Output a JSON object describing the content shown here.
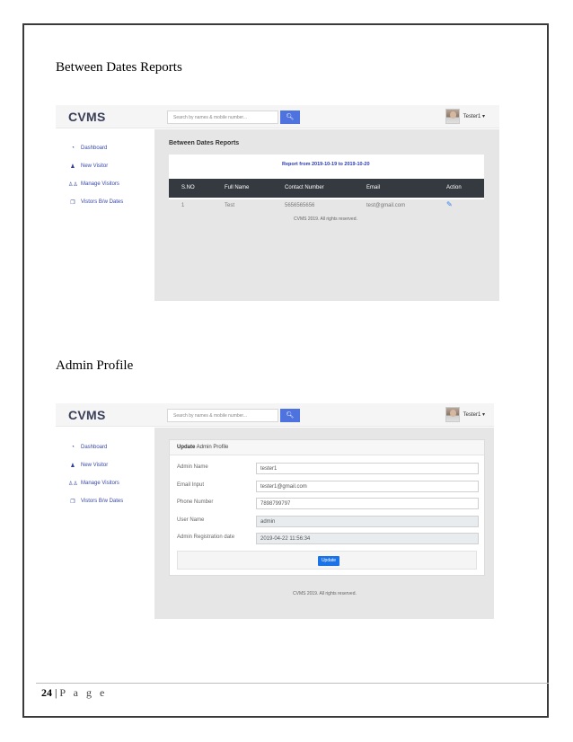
{
  "section1": {
    "heading": "Between Dates Reports"
  },
  "section2": {
    "heading": "Admin Profile"
  },
  "app": {
    "brand": "CVMS",
    "search_placeholder": "Search by names & mobile number...",
    "search_icon": "search-icon",
    "user_name": "Tester1 ▾",
    "sidebar": [
      {
        "label": "Dashboard",
        "icon": "dashboard-icon"
      },
      {
        "label": "New Visitor",
        "icon": "user-icon"
      },
      {
        "label": "Manage Visitors",
        "icon": "users-icon"
      },
      {
        "label": "Vistors B/w Dates",
        "icon": "copy-icon"
      }
    ],
    "footer": "CVMS 2019. All rights reserved."
  },
  "report": {
    "title": "Between Dates Reports",
    "range": "Report from 2019-10-19 to 2019-10-20",
    "columns": [
      "S.NO",
      "Full Name",
      "Contact Number",
      "Email",
      "Action"
    ],
    "rows": [
      {
        "sno": "1",
        "name": "Test",
        "contact": "5656565656",
        "email": "test@gmail.com"
      }
    ]
  },
  "profile": {
    "header_bold": "Update",
    "header_rest": " Admin Profile",
    "fields": [
      {
        "label": "Admin Name",
        "value": "tester1"
      },
      {
        "label": "Email Input",
        "value": "tester1@gmail.com"
      },
      {
        "label": "Phone Number",
        "value": "7898799797"
      },
      {
        "label": "User Name",
        "value": "admin"
      },
      {
        "label": "Admin Registration date",
        "value": "2019-04-22 11:56:34"
      }
    ],
    "update_label": "Update"
  },
  "page_footer": {
    "number": "24",
    "separator": " | ",
    "word": "P a g e"
  }
}
